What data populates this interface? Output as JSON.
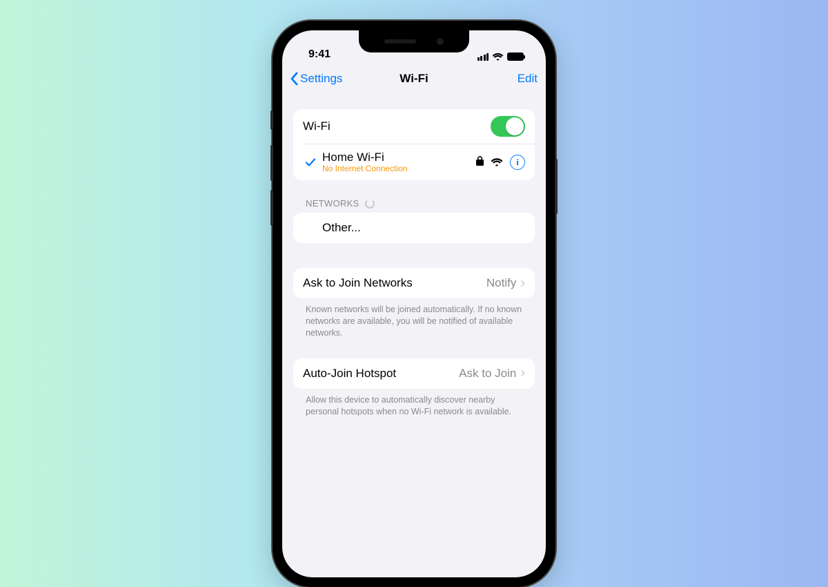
{
  "statusbar": {
    "time": "9:41"
  },
  "nav": {
    "back": "Settings",
    "title": "Wi-Fi",
    "edit": "Edit"
  },
  "toggle_row": {
    "label": "Wi-Fi"
  },
  "connected": {
    "name": "Home Wi-Fi",
    "status": "No Internet Connection"
  },
  "networks_header": "NETWORKS",
  "other_label": "Other...",
  "ask_join": {
    "label": "Ask to Join Networks",
    "value": "Notify",
    "footer": "Known networks will be joined automatically. If no known networks are available, you will be notified of available networks."
  },
  "auto_hotspot": {
    "label": "Auto-Join Hotspot",
    "value": "Ask to Join",
    "footer": "Allow this device to automatically discover nearby personal hotspots when no Wi-Fi network is available."
  }
}
